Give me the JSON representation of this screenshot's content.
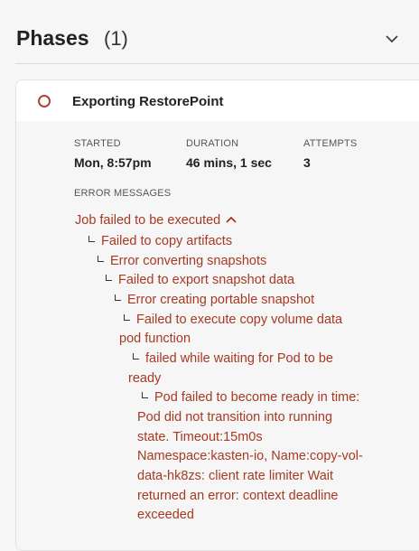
{
  "section": {
    "title": "Phases",
    "count": "(1)"
  },
  "phase": {
    "name": "Exporting RestorePoint",
    "status_color": "#b4412c",
    "started_label": "STARTED",
    "started_value": "Mon, 8:57pm",
    "duration_label": "DURATION",
    "duration_value": "46 mins, 1 sec",
    "attempts_label": "ATTEMPTS",
    "attempts_value": "3",
    "error_label": "ERROR MESSAGES",
    "errors": [
      "Job failed to be executed",
      "Failed to copy artifacts",
      "Error converting snapshots",
      "Failed to export snapshot data",
      "Error creating portable snapshot",
      "Failed to execute copy volume data",
      "pod function",
      "failed while waiting for Pod to be",
      "ready",
      "Pod failed to become ready in time:",
      "Pod did not transition into running",
      "state. Timeout:15m0s",
      "Namespace:kasten-io, Name:copy-vol-",
      "data-hk8zs: client rate limiter Wait",
      "returned an error: context deadline",
      "exceeded"
    ]
  },
  "icons": {
    "collapse": "chevron-down-icon",
    "status": "circle-outline-icon",
    "expand_toggle": "chevron-up-icon",
    "tree_branch": "tree-branch-icon"
  },
  "colors": {
    "error_text": "#a63a23",
    "card_header": "#ffffff",
    "background": "#f6f6f6"
  }
}
